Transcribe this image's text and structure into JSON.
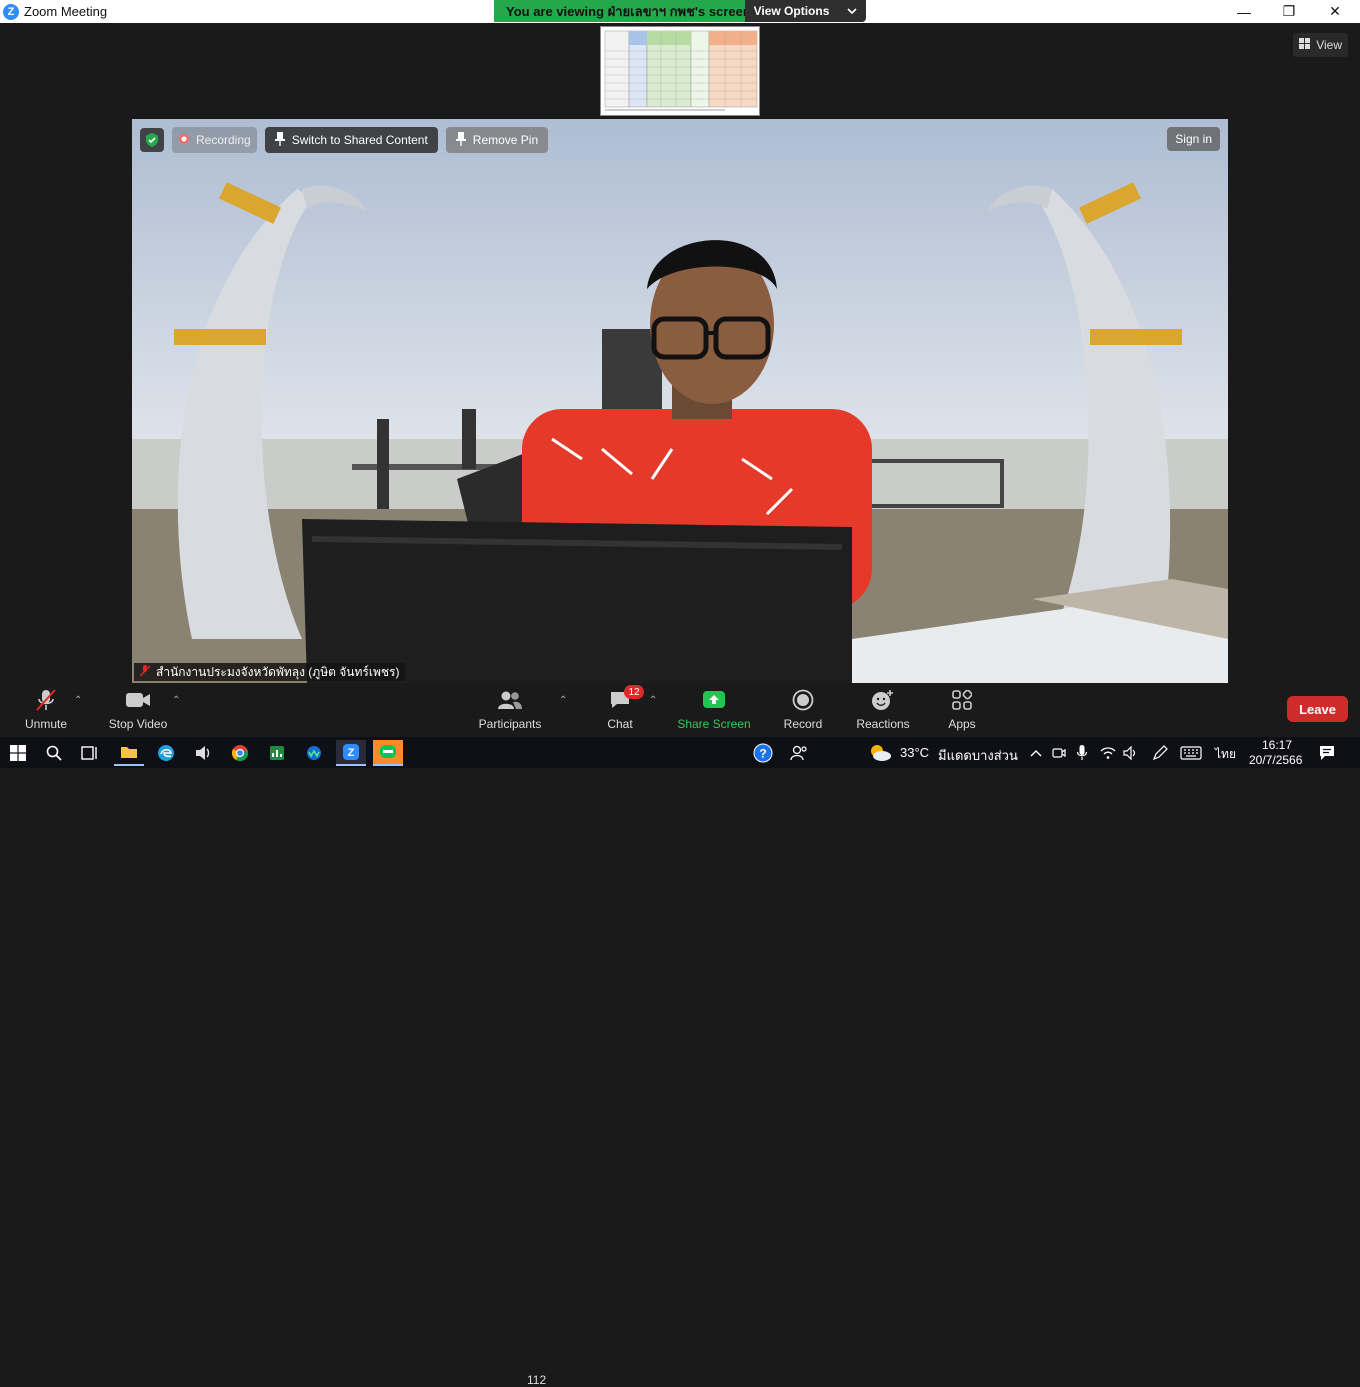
{
  "window": {
    "title": "Zoom Meeting",
    "minimize_glyph": "—",
    "restore_glyph": "❐",
    "close_glyph": "✕"
  },
  "banner": {
    "viewing_text": "You are viewing ฝ่ายเลขาฯ กพช's screen",
    "view_options_label": "View Options"
  },
  "top_right": {
    "view_label": "View"
  },
  "overlay": {
    "recording_label": "Recording",
    "switch_label": "Switch to Shared Content",
    "remove_pin_label": "Remove Pin",
    "sign_in_label": "Sign in"
  },
  "participant": {
    "name": "สำนักงานประมงจังหวัดพัทลุง (ภูษิต  จันทร์เพชร)"
  },
  "toolbar": {
    "unmute_label": "Unmute",
    "stop_video_label": "Stop Video",
    "participants_label": "Participants",
    "participants_count": "112",
    "chat_label": "Chat",
    "chat_badge": "12",
    "share_screen_label": "Share Screen",
    "record_label": "Record",
    "reactions_label": "Reactions",
    "apps_label": "Apps",
    "leave_label": "Leave"
  },
  "taskbar": {
    "weather_temp": "33°C",
    "weather_desc": "มีแดดบางส่วน",
    "language": "ไทย",
    "time": "16:17",
    "date": "20/7/2566"
  },
  "colors": {
    "banner_green": "#23a94c",
    "leave_red": "#d02b2b",
    "share_green": "#2ecc5a",
    "badge_red": "#e02828",
    "zoom_blue": "#2d8cff"
  }
}
